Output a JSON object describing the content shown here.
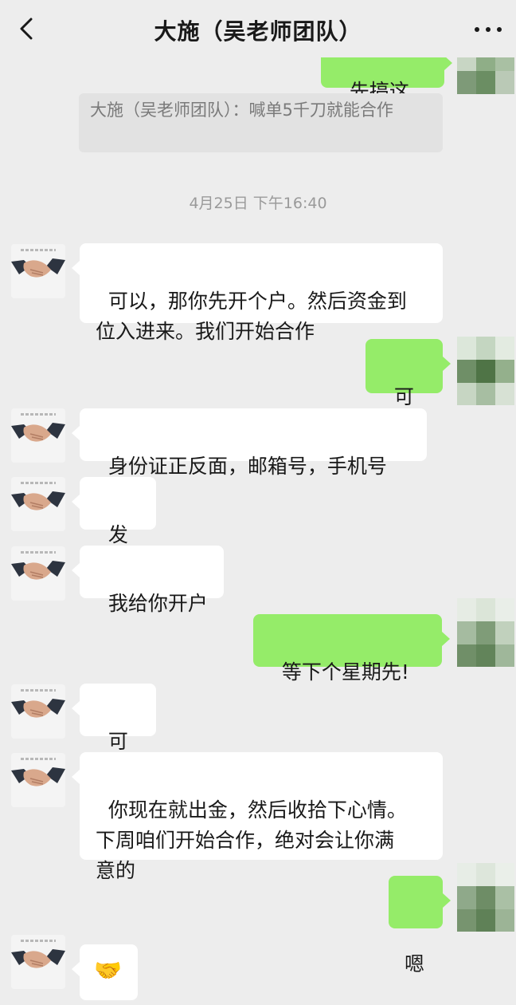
{
  "header": {
    "title": "大施（吴老师团队）"
  },
  "partial_top_message": "先搞这个",
  "quote": {
    "text": "大施（吴老师团队）：喊单5千刀就能合作"
  },
  "timestamp": "4月25日 下午16:40",
  "messages": [
    {
      "from": "contact",
      "text": "可以，那你先开个户。然后资金到\n位入进来。我们开始合作"
    },
    {
      "from": "me",
      "text": "可以"
    },
    {
      "from": "contact",
      "text": "身份证正反面，邮箱号，手机号"
    },
    {
      "from": "contact",
      "text": "发我"
    },
    {
      "from": "contact",
      "text": "我给你开户"
    },
    {
      "from": "me",
      "text": "等下个星期先!"
    },
    {
      "from": "contact",
      "text": "可以"
    },
    {
      "from": "contact",
      "text": "你现在就出金，然后收拾下心情。\n下周咱们开始合作，绝对会让你满\n意的"
    },
    {
      "from": "me",
      "text": "嗯"
    },
    {
      "from": "contact",
      "text": "🤝"
    }
  ],
  "icons": {
    "back": "back-icon",
    "more": "more-icon",
    "contact_avatar": "handshake-avatar",
    "my_avatar": "pixelated-avatar"
  },
  "colors": {
    "background": "#ededed",
    "outgoing_bubble": "#95ec69",
    "incoming_bubble": "#ffffff"
  }
}
